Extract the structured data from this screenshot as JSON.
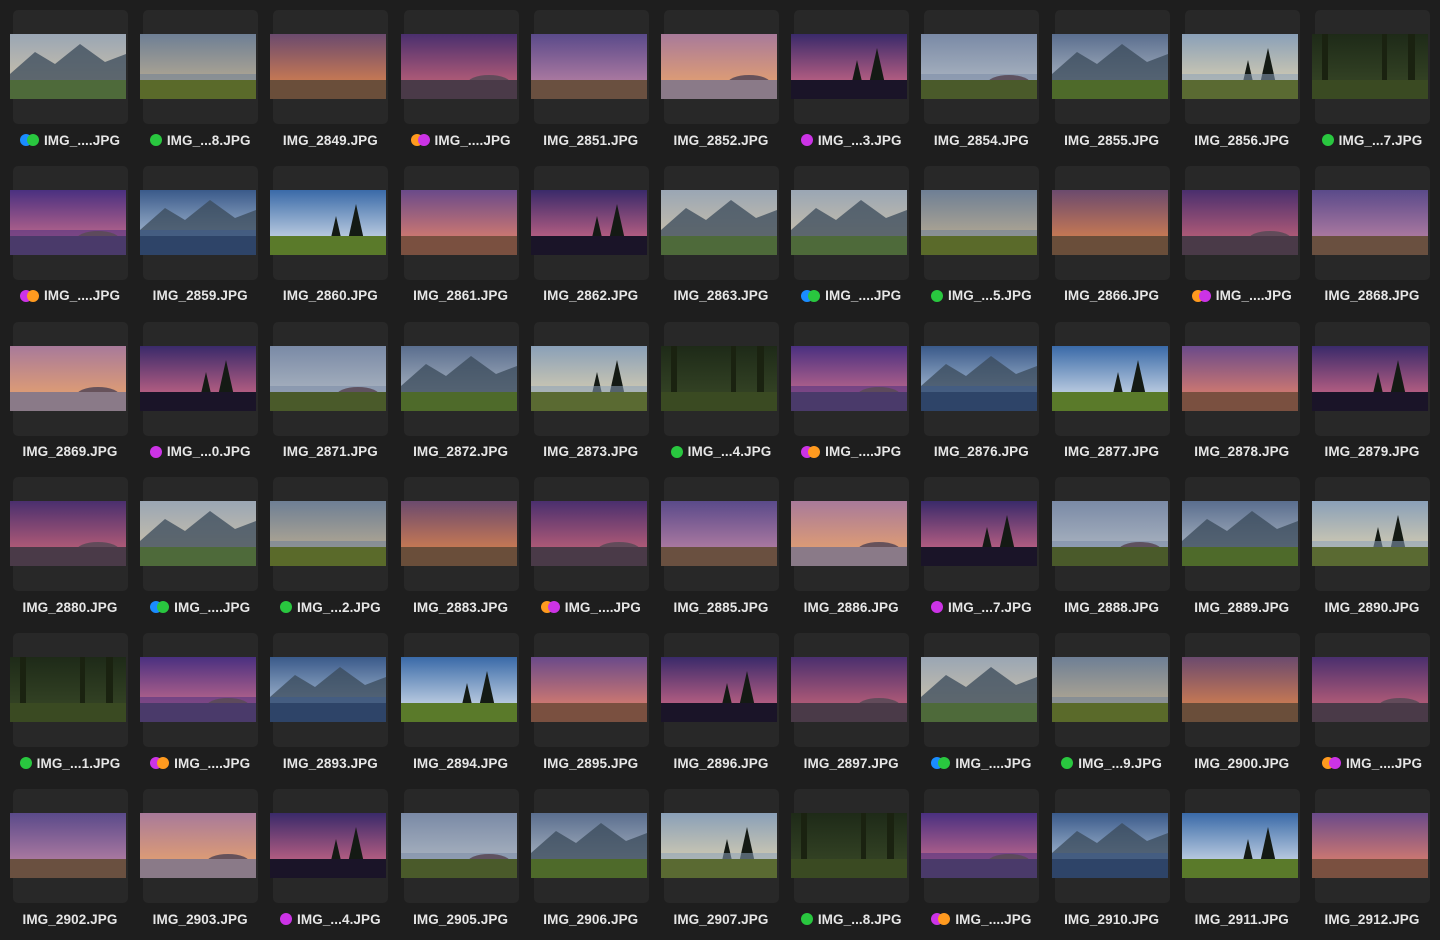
{
  "colors": {
    "background": "#1e1e1e",
    "card": "#282828",
    "label": "#e6e6e6",
    "tag_blue": "#1a8cff",
    "tag_green": "#29c73f",
    "tag_purple": "#cc33e6",
    "tag_orange": "#ff9a1f"
  },
  "scenes": [
    "rock-hill-dusk",
    "lake-meadow",
    "orange-horizon",
    "rocks-purple-sky",
    "purple-plain",
    "coast-cliff",
    "pine-silhouette",
    "cliffs-reflection",
    "mountain-valley",
    "lake-pines",
    "forest-path",
    "purple-lake-rocks",
    "mountain-lake-reflection",
    "alpine-meadow-clouds",
    "pink-sunset-plain"
  ],
  "files": [
    {
      "name": "IMG_....JPG",
      "tags": [
        "blue",
        "green"
      ],
      "scene": "rock-hill-dusk"
    },
    {
      "name": "IMG_...8.JPG",
      "tags": [
        "green"
      ],
      "scene": "lake-meadow"
    },
    {
      "name": "IMG_2849.JPG",
      "tags": [],
      "scene": "orange-horizon"
    },
    {
      "name": "IMG_....JPG",
      "tags": [
        "orange",
        "purple"
      ],
      "scene": "rocks-purple-sky"
    },
    {
      "name": "IMG_2851.JPG",
      "tags": [],
      "scene": "purple-plain"
    },
    {
      "name": "IMG_2852.JPG",
      "tags": [],
      "scene": "coast-cliff"
    },
    {
      "name": "IMG_...3.JPG",
      "tags": [
        "purple"
      ],
      "scene": "pine-silhouette"
    },
    {
      "name": "IMG_2854.JPG",
      "tags": [],
      "scene": "cliffs-reflection"
    },
    {
      "name": "IMG_2855.JPG",
      "tags": [],
      "scene": "mountain-valley"
    },
    {
      "name": "IMG_2856.JPG",
      "tags": [],
      "scene": "lake-pines"
    },
    {
      "name": "IMG_...7.JPG",
      "tags": [
        "green"
      ],
      "scene": "forest-path"
    },
    {
      "name": "IMG_....JPG",
      "tags": [
        "purple",
        "orange"
      ],
      "scene": "purple-lake-rocks"
    },
    {
      "name": "IMG_2859.JPG",
      "tags": [],
      "scene": "mountain-lake-reflection"
    },
    {
      "name": "IMG_2860.JPG",
      "tags": [],
      "scene": "alpine-meadow-clouds"
    },
    {
      "name": "IMG_2861.JPG",
      "tags": [],
      "scene": "pink-sunset-plain"
    },
    {
      "name": "IMG_2862.JPG",
      "tags": [],
      "scene": "pine-silhouette"
    },
    {
      "name": "IMG_2863.JPG",
      "tags": [],
      "scene": "rock-hill-dusk"
    },
    {
      "name": "IMG_....JPG",
      "tags": [
        "blue",
        "green"
      ],
      "scene": "rock-hill-dusk"
    },
    {
      "name": "IMG_...5.JPG",
      "tags": [
        "green"
      ],
      "scene": "lake-meadow"
    },
    {
      "name": "IMG_2866.JPG",
      "tags": [],
      "scene": "orange-horizon"
    },
    {
      "name": "IMG_....JPG",
      "tags": [
        "orange",
        "purple"
      ],
      "scene": "rocks-purple-sky"
    },
    {
      "name": "IMG_2868.JPG",
      "tags": [],
      "scene": "purple-plain"
    },
    {
      "name": "IMG_2869.JPG",
      "tags": [],
      "scene": "coast-cliff"
    },
    {
      "name": "IMG_...0.JPG",
      "tags": [
        "purple"
      ],
      "scene": "pine-silhouette"
    },
    {
      "name": "IMG_2871.JPG",
      "tags": [],
      "scene": "cliffs-reflection"
    },
    {
      "name": "IMG_2872.JPG",
      "tags": [],
      "scene": "mountain-valley"
    },
    {
      "name": "IMG_2873.JPG",
      "tags": [],
      "scene": "lake-pines"
    },
    {
      "name": "IMG_...4.JPG",
      "tags": [
        "green"
      ],
      "scene": "forest-path"
    },
    {
      "name": "IMG_....JPG",
      "tags": [
        "purple",
        "orange"
      ],
      "scene": "purple-lake-rocks"
    },
    {
      "name": "IMG_2876.JPG",
      "tags": [],
      "scene": "mountain-lake-reflection"
    },
    {
      "name": "IMG_2877.JPG",
      "tags": [],
      "scene": "alpine-meadow-clouds"
    },
    {
      "name": "IMG_2878.JPG",
      "tags": [],
      "scene": "pink-sunset-plain"
    },
    {
      "name": "IMG_2879.JPG",
      "tags": [],
      "scene": "pine-silhouette"
    },
    {
      "name": "IMG_2880.JPG",
      "tags": [],
      "scene": "rocks-purple-sky"
    },
    {
      "name": "IMG_....JPG",
      "tags": [
        "blue",
        "green"
      ],
      "scene": "rock-hill-dusk"
    },
    {
      "name": "IMG_...2.JPG",
      "tags": [
        "green"
      ],
      "scene": "lake-meadow"
    },
    {
      "name": "IMG_2883.JPG",
      "tags": [],
      "scene": "orange-horizon"
    },
    {
      "name": "IMG_....JPG",
      "tags": [
        "orange",
        "purple"
      ],
      "scene": "rocks-purple-sky"
    },
    {
      "name": "IMG_2885.JPG",
      "tags": [],
      "scene": "purple-plain"
    },
    {
      "name": "IMG_2886.JPG",
      "tags": [],
      "scene": "coast-cliff"
    },
    {
      "name": "IMG_...7.JPG",
      "tags": [
        "purple"
      ],
      "scene": "pine-silhouette"
    },
    {
      "name": "IMG_2888.JPG",
      "tags": [],
      "scene": "cliffs-reflection"
    },
    {
      "name": "IMG_2889.JPG",
      "tags": [],
      "scene": "mountain-valley"
    },
    {
      "name": "IMG_2890.JPG",
      "tags": [],
      "scene": "lake-pines"
    },
    {
      "name": "IMG_...1.JPG",
      "tags": [
        "green"
      ],
      "scene": "forest-path"
    },
    {
      "name": "IMG_....JPG",
      "tags": [
        "purple",
        "orange"
      ],
      "scene": "purple-lake-rocks"
    },
    {
      "name": "IMG_2893.JPG",
      "tags": [],
      "scene": "mountain-lake-reflection"
    },
    {
      "name": "IMG_2894.JPG",
      "tags": [],
      "scene": "alpine-meadow-clouds"
    },
    {
      "name": "IMG_2895.JPG",
      "tags": [],
      "scene": "pink-sunset-plain"
    },
    {
      "name": "IMG_2896.JPG",
      "tags": [],
      "scene": "pine-silhouette"
    },
    {
      "name": "IMG_2897.JPG",
      "tags": [],
      "scene": "rocks-purple-sky"
    },
    {
      "name": "IMG_....JPG",
      "tags": [
        "blue",
        "green"
      ],
      "scene": "rock-hill-dusk"
    },
    {
      "name": "IMG_...9.JPG",
      "tags": [
        "green"
      ],
      "scene": "lake-meadow"
    },
    {
      "name": "IMG_2900.JPG",
      "tags": [],
      "scene": "orange-horizon"
    },
    {
      "name": "IMG_....JPG",
      "tags": [
        "orange",
        "purple"
      ],
      "scene": "rocks-purple-sky"
    },
    {
      "name": "IMG_2902.JPG",
      "tags": [],
      "scene": "purple-plain"
    },
    {
      "name": "IMG_2903.JPG",
      "tags": [],
      "scene": "coast-cliff"
    },
    {
      "name": "IMG_...4.JPG",
      "tags": [
        "purple"
      ],
      "scene": "pine-silhouette"
    },
    {
      "name": "IMG_2905.JPG",
      "tags": [],
      "scene": "cliffs-reflection"
    },
    {
      "name": "IMG_2906.JPG",
      "tags": [],
      "scene": "mountain-valley"
    },
    {
      "name": "IMG_2907.JPG",
      "tags": [],
      "scene": "lake-pines"
    },
    {
      "name": "IMG_...8.JPG",
      "tags": [
        "green"
      ],
      "scene": "forest-path"
    },
    {
      "name": "IMG_....JPG",
      "tags": [
        "purple",
        "orange"
      ],
      "scene": "purple-lake-rocks"
    },
    {
      "name": "IMG_2910.JPG",
      "tags": [],
      "scene": "mountain-lake-reflection"
    },
    {
      "name": "IMG_2911.JPG",
      "tags": [],
      "scene": "alpine-meadow-clouds"
    },
    {
      "name": "IMG_2912.JPG",
      "tags": [],
      "scene": "pink-sunset-plain"
    }
  ]
}
